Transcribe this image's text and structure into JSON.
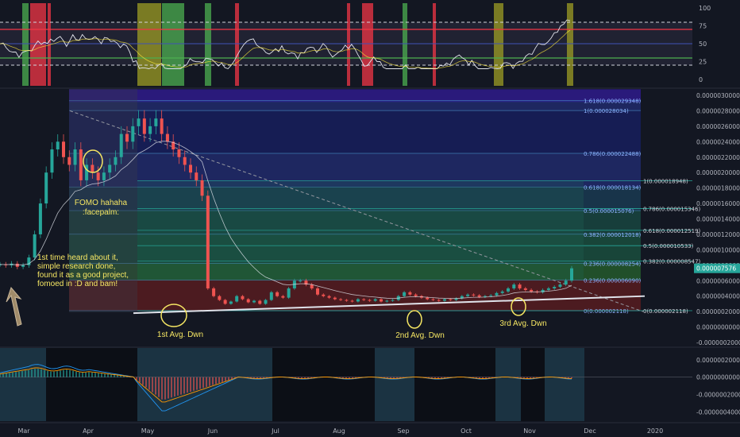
{
  "chart_data": {
    "type": "line",
    "x_labels": [
      "Mar",
      "Apr",
      "May",
      "Jun",
      "Jul",
      "Aug",
      "Sep",
      "Oct",
      "Nov",
      "Dec",
      "2020"
    ],
    "rsi": {
      "ticks": [
        "100",
        "75",
        "50",
        "25",
        "0"
      ],
      "upper_band": 80,
      "lower_band": 20,
      "overbought": 70,
      "oversold": 30
    },
    "price": {
      "ticks": [
        "0.0000030000",
        "0.0000028000",
        "0.0000026000",
        "0.0000024000",
        "0.0000022000",
        "0.0000020000",
        "0.0000018000",
        "0.0000016000",
        "0.0000014000",
        "0.0000012000",
        "0.0000010000",
        "0.0000008000",
        "0.0000006000",
        "0.0000004000",
        "0.0000002000",
        "0.0000000000",
        "-0.0000002000"
      ],
      "ylim": [
        -2e-07,
        3e-06
      ],
      "current_price_label": "0.000007576",
      "current_price": 7.6e-07,
      "fib_left": [
        {
          "label": "1.618(0.000029348)",
          "value": 2.9348e-06
        },
        {
          "label": "1(0.000028034)",
          "value": 2.8034e-06
        },
        {
          "label": "0.786(0.000022488)",
          "value": 2.2488e-06
        },
        {
          "label": "0.618(0.000018134)",
          "value": 1.8134e-06
        },
        {
          "label": "0.5(0.000015076)",
          "value": 1.5076e-06
        },
        {
          "label": "0.382(0.000012018)",
          "value": 1.2018e-06
        },
        {
          "label": "0.236(0.000008254)",
          "value": 8.254e-07
        },
        {
          "label": "0.236(0.000006090)",
          "value": 6.09e-07
        },
        {
          "label": "0(0.000002118)",
          "value": 2.118e-07
        }
      ],
      "fib_right": [
        {
          "label": "1(0.000018948)",
          "value": 1.8948e-06
        },
        {
          "label": "0.786(0.000015346)",
          "value": 1.5346e-06
        },
        {
          "label": "0.618(0.000012519)",
          "value": 1.2519e-06
        },
        {
          "label": "0.5(0.000010533)",
          "value": 1.0533e-06
        },
        {
          "label": "0.382(0.000008547)",
          "value": 8.547e-07
        },
        {
          "label": "0(0.000002118)",
          "value": 2.118e-07
        }
      ],
      "close_series": [
        8.1e-07,
        8e-07,
        8.2e-07,
        7.8e-07,
        8e-07,
        9e-07,
        1.2e-06,
        1.6e-06,
        2e-06,
        2.3e-06,
        2.4e-06,
        2.2e-06,
        2.1e-06,
        2.3e-06,
        1.9e-06,
        2.1e-06,
        2e-06,
        1.9e-06,
        2e-06,
        2.1e-06,
        2.2e-06,
        2.5e-06,
        2.4e-06,
        2.6e-06,
        2.7e-06,
        2.5e-06,
        2.6e-06,
        2.7e-06,
        2.5e-06,
        2.4e-06,
        2.3e-06,
        2.2e-06,
        2.1e-06,
        2e-06,
        1.9e-06,
        1.7e-06,
        5e-07,
        4e-07,
        3.5e-07,
        3e-07,
        3.3e-07,
        4e-07,
        3.6e-07,
        3.2e-07,
        3.4e-07,
        3e-07,
        3.5e-07,
        4.5e-07,
        4e-07,
        3.8e-07,
        5e-07,
        6e-07,
        6e-07,
        5.5e-07,
        5e-07,
        4.2e-07,
        4e-07,
        3.8e-07,
        3.6e-07,
        3.5e-07,
        3.4e-07,
        3.3e-07,
        3.6e-07,
        3.5e-07,
        3.4e-07,
        3.6e-07,
        3.3e-07,
        3.4e-07,
        3.5e-07,
        4e-07,
        4.5e-07,
        4.2e-07,
        4e-07,
        3.8e-07,
        3.6e-07,
        3.5e-07,
        3.4e-07,
        3.6e-07,
        3.5e-07,
        3.7e-07,
        4e-07,
        4.2e-07,
        4.1e-07,
        3.9e-07,
        4e-07,
        4.1e-07,
        4.4e-07,
        4.6e-07,
        5e-07,
        5.5e-07,
        5e-07,
        4.8e-07,
        4.6e-07,
        4.5e-07,
        4.8e-07,
        5e-07,
        5.2e-07,
        5.5e-07,
        6e-07,
        7.6e-07
      ]
    },
    "macd": {
      "ticks": [
        "0.0000002000",
        "0.0000000000",
        "-0.0000002000",
        "-0.0000004000"
      ],
      "ylim": [
        -4.5e-07,
        2.8e-07
      ]
    },
    "annotations": [
      {
        "id": "fomo",
        "text": "FOMO hahaha\n:facepalm:"
      },
      {
        "id": "first",
        "text": "1st time heard about it,\nsimple research done,\nfound it as a good project,\nfomoed in :D and bam!"
      },
      {
        "id": "avg1",
        "text": "1st Avg. Dwn"
      },
      {
        "id": "avg2",
        "text": "2nd Avg. Dwn"
      },
      {
        "id": "avg3",
        "text": "3rd Avg. Dwn"
      }
    ],
    "colors": {
      "background": "#131722",
      "rsi_line": "#e1e3eb",
      "rsi_ma": "#ffeb3b",
      "red_band": "#f23645",
      "green_band": "#4caf50",
      "fib_line": "#4a90c8",
      "price_label_bg": "#26a69a",
      "annotation": "#f5e663"
    }
  }
}
